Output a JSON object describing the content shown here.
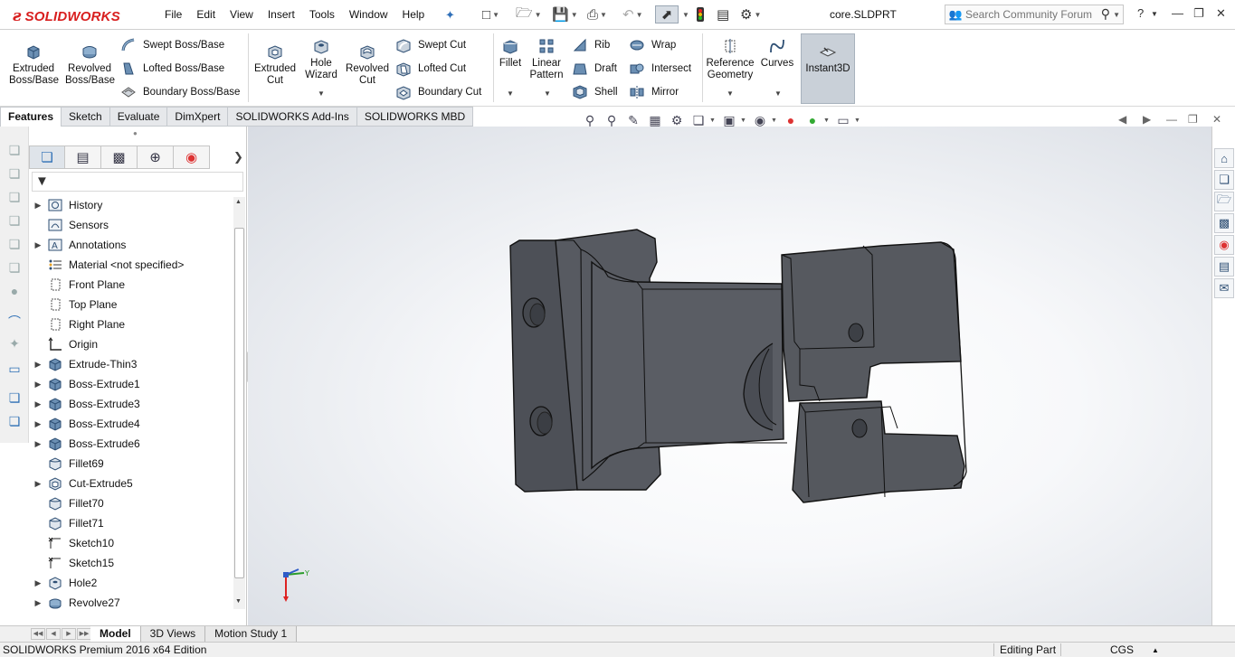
{
  "app": {
    "brand": "SOLIDWORKS",
    "document_name": "core.SLDPRT",
    "colors": {
      "brand_red": "#d81e1e",
      "model_body": "#55585f",
      "model_face": "#4a4d54",
      "selected_button": "#c9d0d8"
    }
  },
  "menu": [
    "File",
    "Edit",
    "View",
    "Insert",
    "Tools",
    "Window",
    "Help"
  ],
  "search": {
    "placeholder": "Search Community Forum"
  },
  "command_manager": {
    "large_buttons": [
      {
        "label1": "Extruded",
        "label2": "Boss/Base",
        "icon": "extruded-boss-icon"
      },
      {
        "label1": "Revolved",
        "label2": "Boss/Base",
        "icon": "revolved-boss-icon"
      },
      {
        "label1": "Extruded",
        "label2": "Cut",
        "icon": "extruded-cut-icon"
      },
      {
        "label1": "Hole",
        "label2": "Wizard",
        "icon": "hole-wizard-icon"
      },
      {
        "label1": "Revolved",
        "label2": "Cut",
        "icon": "revolved-cut-icon"
      },
      {
        "label1": "Fillet",
        "label2": "",
        "icon": "fillet-icon"
      },
      {
        "label1": "Linear",
        "label2": "Pattern",
        "icon": "linear-pattern-icon"
      },
      {
        "label1": "Reference",
        "label2": "Geometry",
        "icon": "reference-geometry-icon"
      },
      {
        "label1": "Curves",
        "label2": "",
        "icon": "curves-icon"
      }
    ],
    "small_buttons": {
      "swept_boss": "Swept Boss/Base",
      "lofted_boss": "Lofted Boss/Base",
      "boundary_boss": "Boundary Boss/Base",
      "swept_cut": "Swept Cut",
      "lofted_cut": "Lofted Cut",
      "boundary_cut": "Boundary Cut",
      "rib": "Rib",
      "draft": "Draft",
      "shell": "Shell",
      "wrap": "Wrap",
      "intersect": "Intersect",
      "mirror": "Mirror"
    },
    "instant3d": "Instant3D"
  },
  "tabs": [
    {
      "label": "Features",
      "active": true
    },
    {
      "label": "Sketch"
    },
    {
      "label": "Evaluate"
    },
    {
      "label": "DimXpert"
    },
    {
      "label": "SOLIDWORKS Add-Ins"
    },
    {
      "label": "SOLIDWORKS MBD"
    }
  ],
  "feature_tree": [
    {
      "label": "History",
      "icon": "history-icon",
      "expandable": true
    },
    {
      "label": "Sensors",
      "icon": "sensors-icon",
      "expandable": false
    },
    {
      "label": "Annotations",
      "icon": "annotations-icon",
      "expandable": true
    },
    {
      "label": "Material <not specified>",
      "icon": "material-icon",
      "expandable": false
    },
    {
      "label": "Front Plane",
      "icon": "plane-icon",
      "expandable": false
    },
    {
      "label": "Top Plane",
      "icon": "plane-icon",
      "expandable": false
    },
    {
      "label": "Right Plane",
      "icon": "plane-icon",
      "expandable": false
    },
    {
      "label": "Origin",
      "icon": "origin-icon",
      "expandable": false
    },
    {
      "label": "Extrude-Thin3",
      "icon": "extrude-feature-icon",
      "expandable": true
    },
    {
      "label": "Boss-Extrude1",
      "icon": "extrude-feature-icon",
      "expandable": true
    },
    {
      "label": "Boss-Extrude3",
      "icon": "extrude-feature-icon",
      "expandable": true
    },
    {
      "label": "Boss-Extrude4",
      "icon": "extrude-feature-icon",
      "expandable": true
    },
    {
      "label": "Boss-Extrude6",
      "icon": "extrude-feature-icon",
      "expandable": true
    },
    {
      "label": "Fillet69",
      "icon": "fillet-feature-icon",
      "expandable": false
    },
    {
      "label": "Cut-Extrude5",
      "icon": "cut-extrude-icon",
      "expandable": true
    },
    {
      "label": "Fillet70",
      "icon": "fillet-feature-icon",
      "expandable": false
    },
    {
      "label": "Fillet71",
      "icon": "fillet-feature-icon",
      "expandable": false
    },
    {
      "label": "Sketch10",
      "icon": "sketch-icon",
      "expandable": false
    },
    {
      "label": "Sketch15",
      "icon": "sketch-icon",
      "expandable": false
    },
    {
      "label": "Hole2",
      "icon": "hole-feature-icon",
      "expandable": true
    },
    {
      "label": "Revolve27",
      "icon": "revolve-feature-icon",
      "expandable": true
    }
  ],
  "bottom_tabs": [
    {
      "label": "Model",
      "active": true
    },
    {
      "label": "3D Views"
    },
    {
      "label": "Motion Study 1"
    }
  ],
  "status": {
    "edition": "SOLIDWORKS Premium 2016 x64 Edition",
    "mode": "Editing Part",
    "units": "CGS"
  }
}
